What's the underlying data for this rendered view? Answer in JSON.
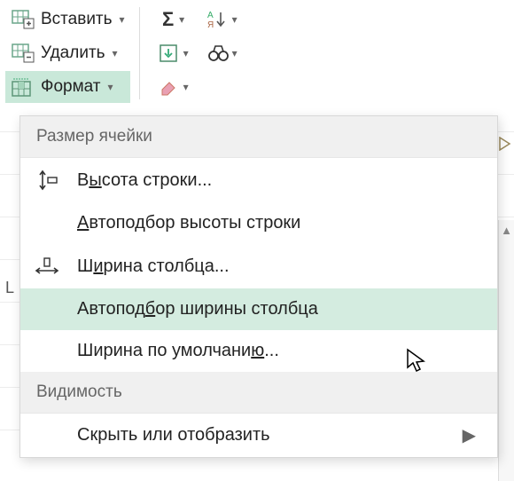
{
  "toolbar": {
    "insert_label": "Вставить",
    "delete_label": "Удалить",
    "format_label": "Формат"
  },
  "icons": {
    "insert": "insert-cells-icon",
    "delete": "delete-cells-icon",
    "format": "format-cells-icon",
    "sum": "sigma-icon",
    "fill": "fill-down-icon",
    "clear": "eraser-icon",
    "sort": "sort-az-icon",
    "find": "binoculars-icon"
  },
  "menu": {
    "section_cell_size": "Размер ячейки",
    "row_height": "Высота строки...",
    "autofit_row_height": "Автоподбор высоты строки",
    "column_width": "Ширина столбца...",
    "autofit_column_width": "Автоподбор ширины столбца",
    "default_width": "Ширина по умолчанию...",
    "section_visibility": "Видимость",
    "hide_unhide": "Скрыть или отобразить"
  },
  "sheet": {
    "column_label": "L"
  }
}
